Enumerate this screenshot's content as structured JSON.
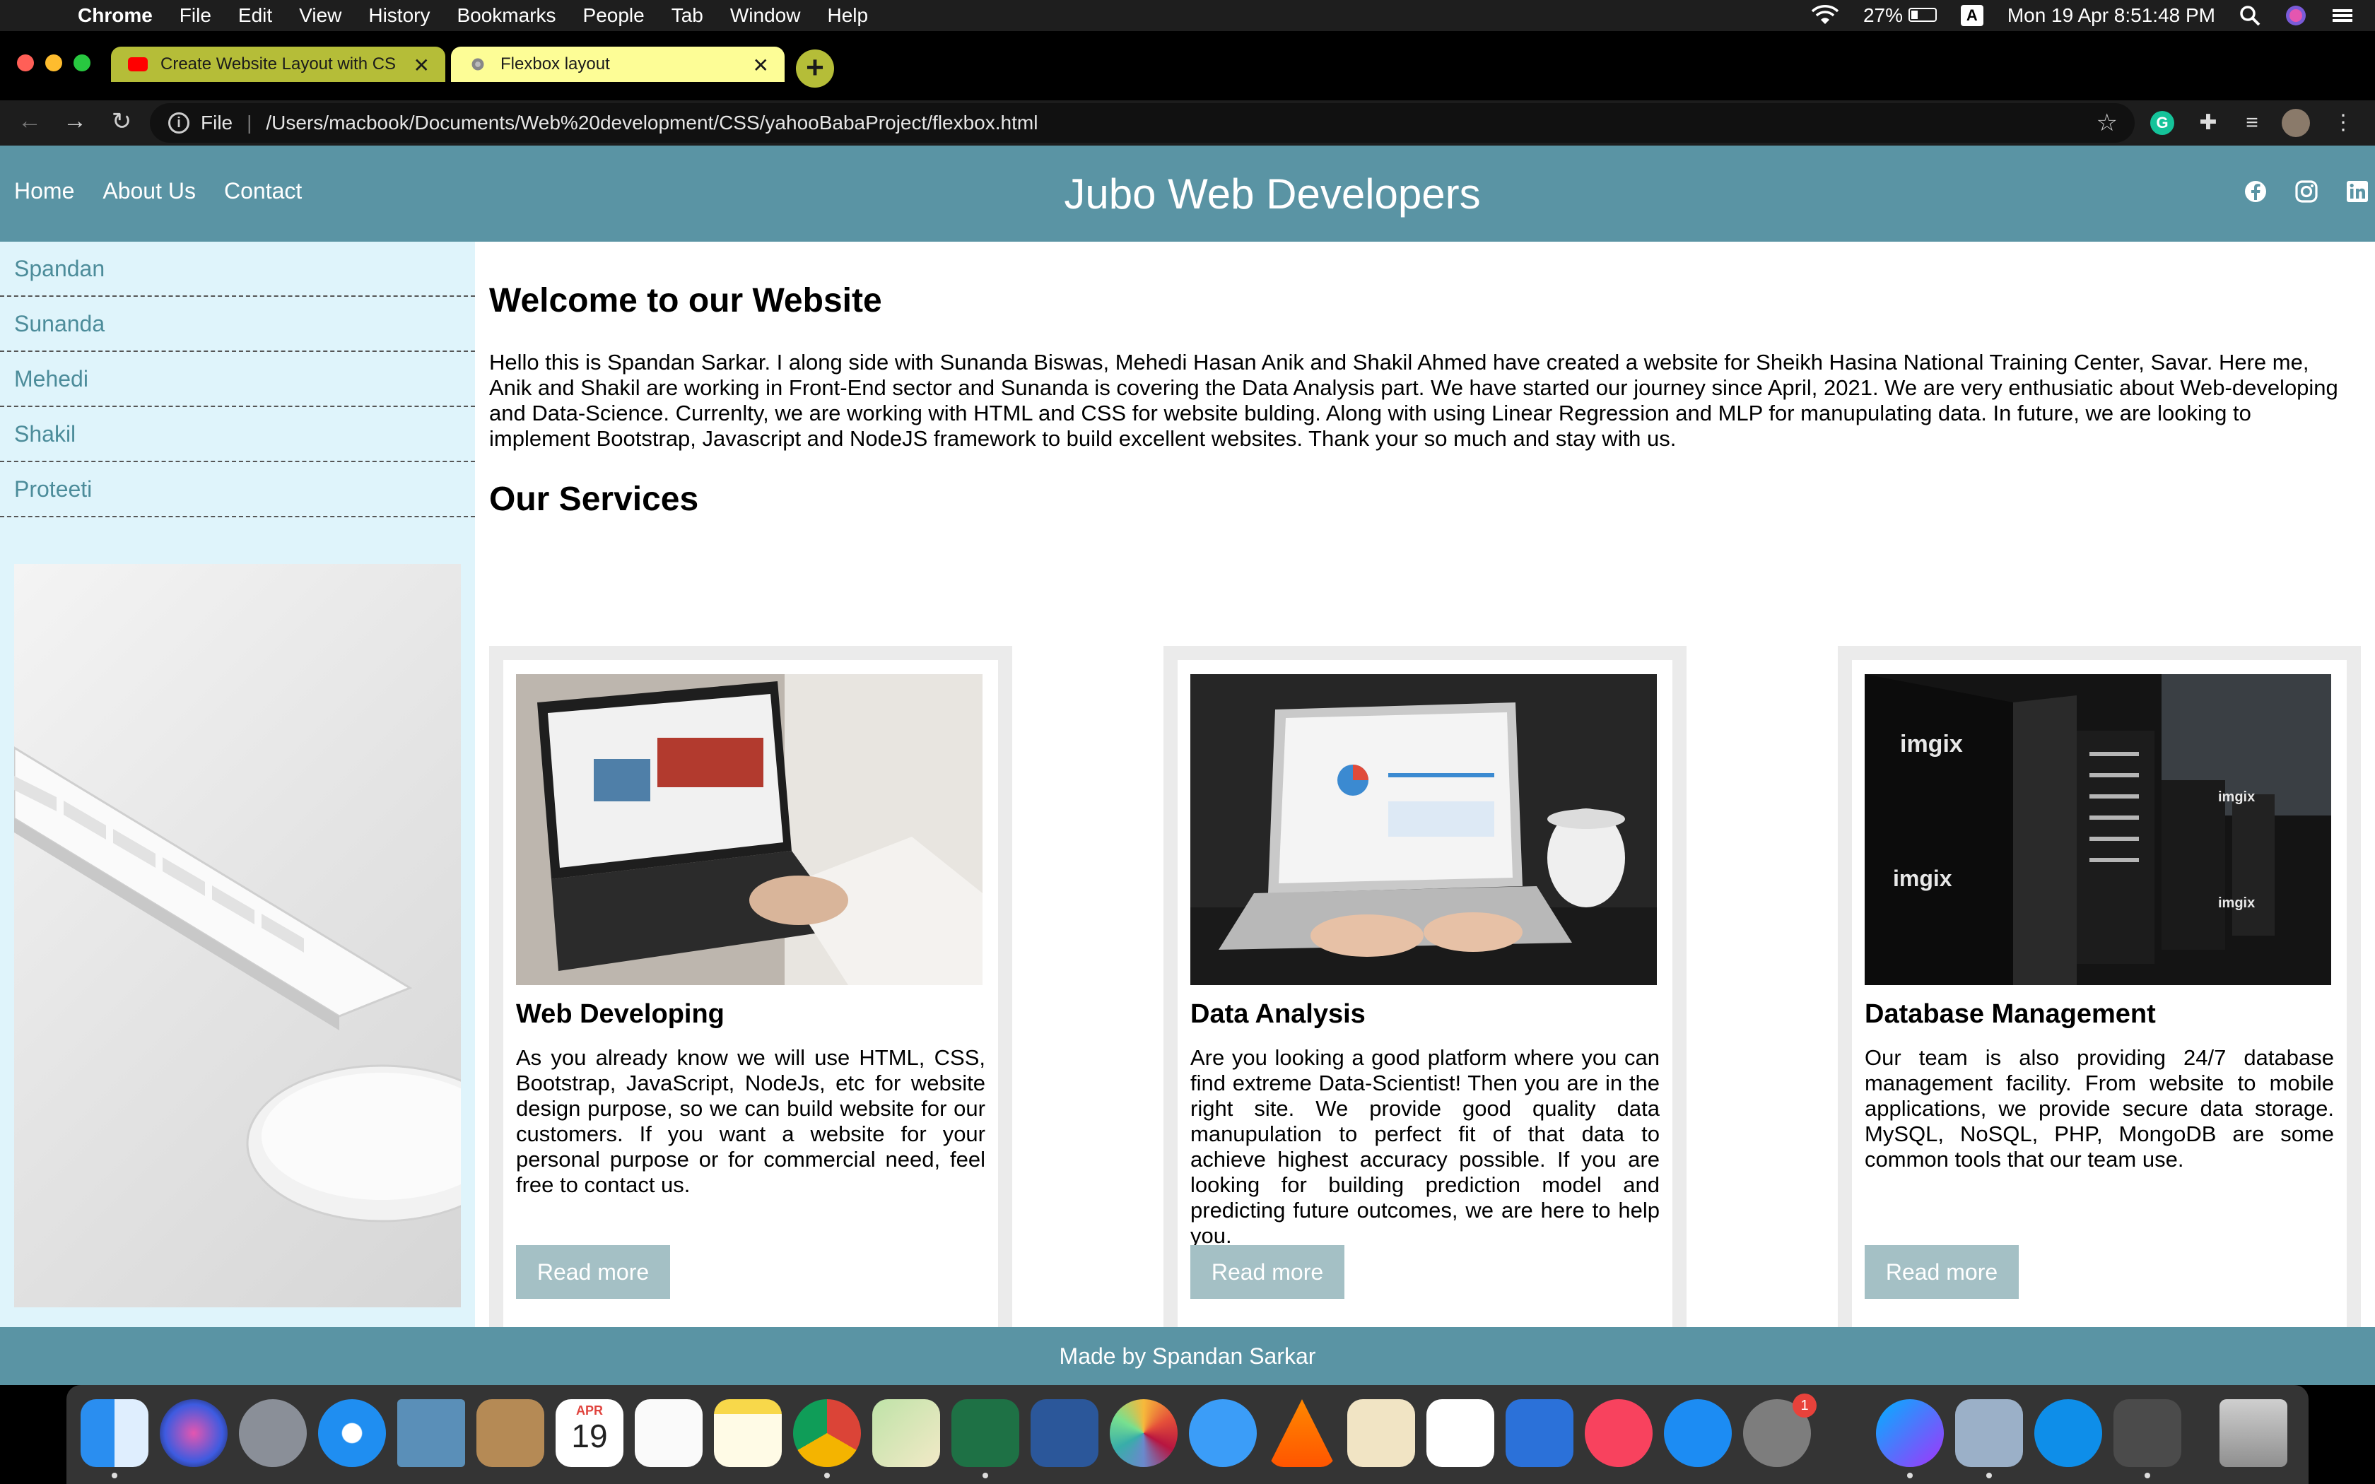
{
  "menubar": {
    "app": "Chrome",
    "items": [
      "File",
      "Edit",
      "View",
      "History",
      "Bookmarks",
      "People",
      "Tab",
      "Window",
      "Help"
    ],
    "battery": "27%",
    "input_indicator": "A",
    "clock": "Mon 19 Apr  8:51:48 PM"
  },
  "tabs": [
    {
      "title": "Create Website Layout with CS"
    },
    {
      "title": "Flexbox layout"
    }
  ],
  "address": {
    "scheme_label": "File",
    "url": "/Users/macbook/Documents/Web%20development/CSS/yahooBabaProject/flexbox.html"
  },
  "site": {
    "nav": [
      "Home",
      "About Us",
      "Contact"
    ],
    "title": "Jubo Web Developers",
    "social_icons": [
      "facebook-icon",
      "instagram-icon",
      "linkedin-icon"
    ],
    "sidebar_links": [
      "Spandan",
      "Sunanda",
      "Mehedi",
      "Shakil",
      "Proteeti"
    ],
    "welcome_title": "Welcome to our Website",
    "welcome_text": "Hello this is Spandan Sarkar. I along side with Sunanda Biswas, Mehedi Hasan Anik and Shakil Ahmed have created a website for Sheikh Hasina National Training Center, Savar. Here me, Anik and Shakil are working in Front-End sector and Sunanda is covering the Data Analysis part. We have started our journey since April, 2021. We are very enthusiatic about Web-developing and Data-Science. Currenlty, we are working with HTML and CSS for website bulding. Along with using Linear Regression and MLP for manupulating data. In future, we are looking to implement Bootstrap, Javascript and NodeJS framework to build excellent websites. Thank your so much and stay with us.",
    "services_title": "Our Services",
    "services": [
      {
        "title": "Web Developing",
        "text": "As you already know we will use HTML, CSS, Bootstrap, JavaScript, NodeJs, etc for website design purpose, so we can build website for our customers. If you want a website for your personal purpose or for commercial need, feel free to contact us.",
        "button": "Read more"
      },
      {
        "title": "Data Analysis",
        "text": "Are you looking a good platform where you can find extreme Data-Scientist! Then you are in the right site. We provide good quality data manupulation to perfect fit of that data to achieve highest accuracy possible. If you are looking for building prediction model and predicting future outcomes, we are here to help you.",
        "button": "Read more"
      },
      {
        "title": "Database Management",
        "text": "Our team is also providing 24/7 database management facility. From website to mobile applications, we provide secure data storage. MySQL, NoSQL, PHP, MongoDB are some common tools that our team use.",
        "button": "Read more"
      }
    ],
    "server_logo": "imgix",
    "footer": "Made by Spandan Sarkar"
  },
  "dock": {
    "calendar_month": "APR",
    "calendar_day": "19",
    "settings_badge": "1"
  },
  "colors": {
    "header_bg": "#5a94a4",
    "sidebar_bg": "#dff4fb",
    "sidebar_link": "#4c8c9a",
    "button_bg": "#a4c0c5",
    "tab_active": "#fdfd96",
    "tab_inactive": "#b5bd38"
  }
}
